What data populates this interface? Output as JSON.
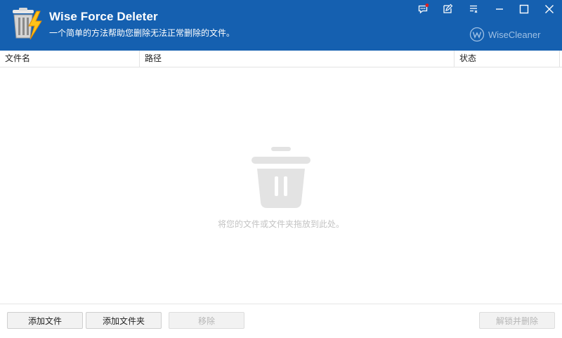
{
  "app": {
    "title": "Wise Force Deleter",
    "subtitle": "一个简单的方法帮助您删除无法正常删除的文件。",
    "brand": "WiseCleaner",
    "brand_icon": "wisecleaner-logo-icon",
    "logo_icon": "trash-lightning-logo-icon"
  },
  "window_controls": [
    {
      "name": "feedback-icon",
      "has_badge": true
    },
    {
      "name": "notes-icon"
    },
    {
      "name": "settings-menu-icon"
    },
    {
      "name": "minimize-icon"
    },
    {
      "name": "maximize-icon"
    },
    {
      "name": "close-icon"
    }
  ],
  "table": {
    "columns": [
      "文件名",
      "路径",
      "状态"
    ],
    "rows": []
  },
  "empty_state": {
    "icon": "trash-bin-icon",
    "hint": "将您的文件或文件夹拖放到此处。"
  },
  "buttons": {
    "add_file": "添加文件",
    "add_folder": "添加文件夹",
    "remove": "移除",
    "unlock_delete": "解锁并删除"
  },
  "colors": {
    "titlebar": "#1560b0",
    "badge": "#e02020",
    "disabled_text": "#b6b6b6"
  }
}
